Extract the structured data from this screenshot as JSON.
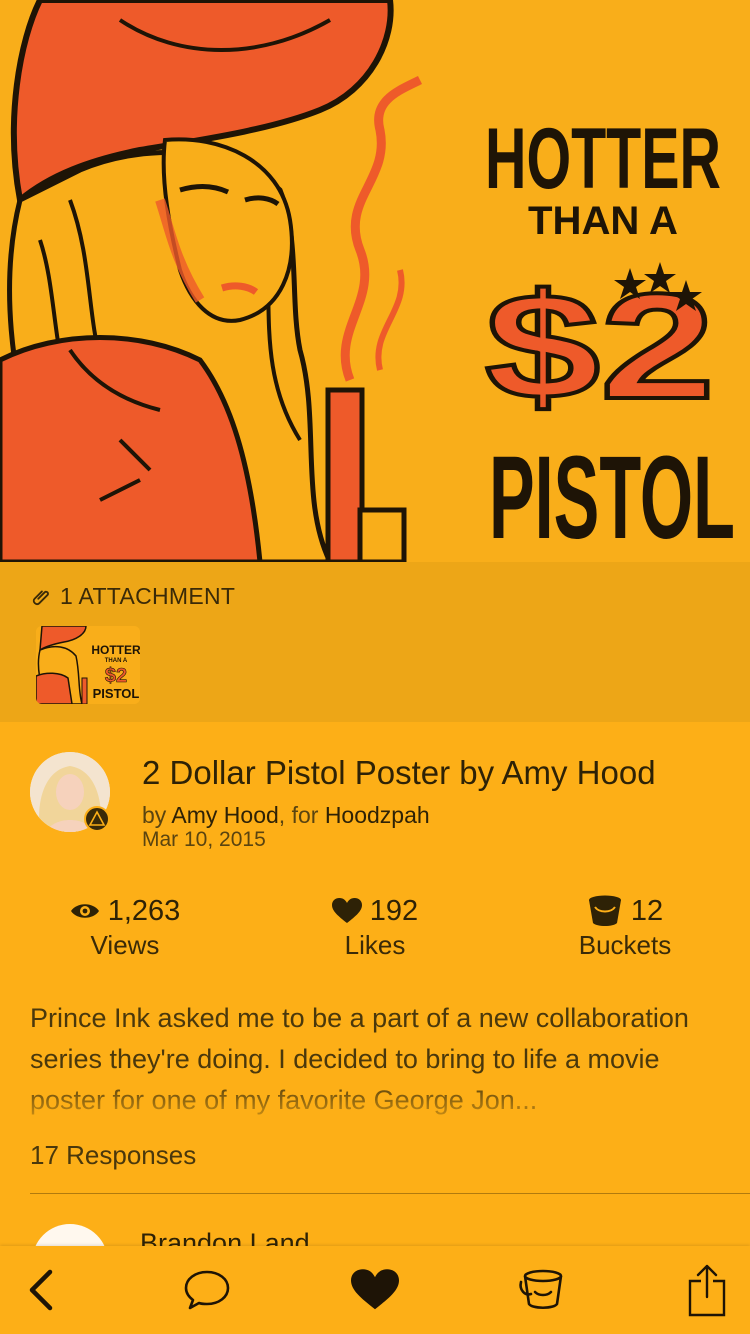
{
  "hero": {
    "poster_lines": [
      "HOTTER",
      "THAN A",
      "$2",
      "PISTOL"
    ]
  },
  "attachments": {
    "label": "1 ATTACHMENT"
  },
  "shot": {
    "title": "2 Dollar Pistol Poster by Amy Hood",
    "by_prefix": "by ",
    "author": "Amy Hood",
    "for_prefix": ", for ",
    "team": "Hoodzpah",
    "date": "Mar 10, 2015"
  },
  "stats": {
    "views": {
      "value": "1,263",
      "label": "Views"
    },
    "likes": {
      "value": "192",
      "label": "Likes"
    },
    "buckets": {
      "value": "12",
      "label": "Buckets"
    }
  },
  "description": "Prince Ink asked me to be a part of a new collaboration series they're doing. I decided to bring to life a movie poster for one of my favorite George Jon...",
  "responses": {
    "count_label": "17 Responses",
    "first_name": "Brandon Land"
  },
  "toolbar": {
    "icons": [
      "chevron-left-icon",
      "comment-icon",
      "heart-icon",
      "bucket-icon",
      "share-icon"
    ]
  },
  "colors": {
    "background": "#FDAF17",
    "attachment_band": "#EDA617",
    "text_dark": "#2E2206",
    "poster_orange": "#EE5A2A"
  }
}
